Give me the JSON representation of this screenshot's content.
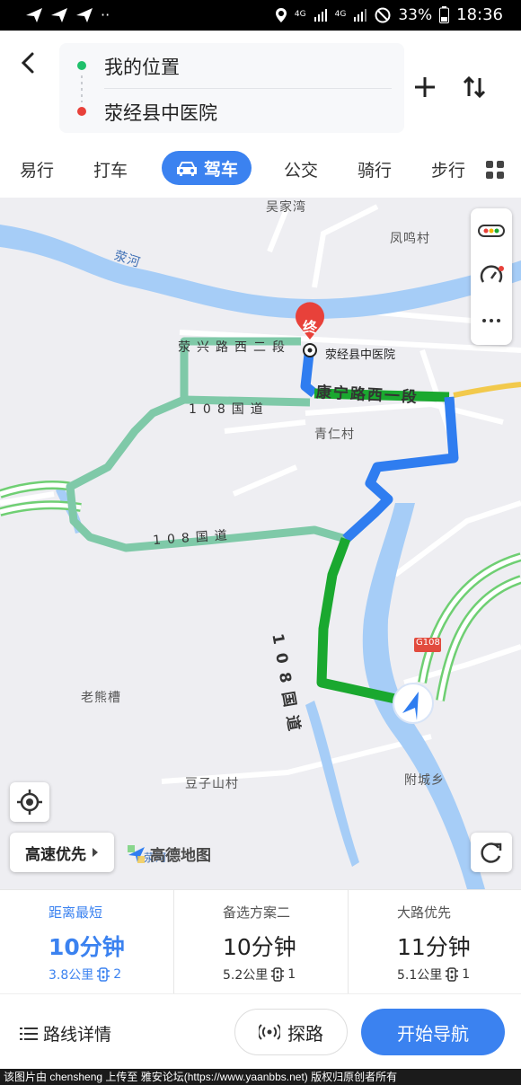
{
  "status_bar": {
    "network_top": "4G",
    "network_bottom": "4G",
    "battery": "33%",
    "time": "18:36"
  },
  "route": {
    "start": "我的位置",
    "end": "荥经县中医院"
  },
  "modes": {
    "items": [
      "易行",
      "打车",
      "公交",
      "骑行",
      "步行"
    ],
    "active": "驾车"
  },
  "map": {
    "labels": {
      "wujiawan": "吴家湾",
      "fengmingcun": "凤鸣村",
      "yinghe": "荥河",
      "qingrencun": "青仁村",
      "laoxiongcao": "老熊槽",
      "douzishancun": "豆子山村",
      "fuchengxiang": "附城乡",
      "g108": "G108",
      "yinghe2": "荥河"
    },
    "roads": {
      "xingxing": "荥兴路西二段",
      "guodao_top": "108国道",
      "guodao_mid": "108国道",
      "kangning": "康宁路西一段",
      "guodao_route": "108国道"
    },
    "destination_marker": "终",
    "destination_label": "荥经县中医院",
    "priority": "高速优先",
    "logo": "高德地图",
    "colors": {
      "route_blue": "#2f7df0",
      "route_green": "#1aa82f",
      "alt_route": "#7fc9a8",
      "water": "#a6cdf7"
    }
  },
  "plans": [
    {
      "name": "距离最短",
      "time": "10分钟",
      "distance": "3.8公里",
      "lights": "2",
      "active": true
    },
    {
      "name": "备选方案二",
      "time": "10分钟",
      "distance": "5.2公里",
      "lights": "1",
      "active": false
    },
    {
      "name": "大路优先",
      "time": "11分钟",
      "distance": "5.1公里",
      "lights": "1",
      "active": false
    }
  ],
  "bottom": {
    "details": "路线详情",
    "explore": "探路",
    "start_nav": "开始导航"
  },
  "watermark": "该图片由 chensheng 上传至 雅安论坛(https://www.yaanbbs.net) 版权归原创者所有"
}
